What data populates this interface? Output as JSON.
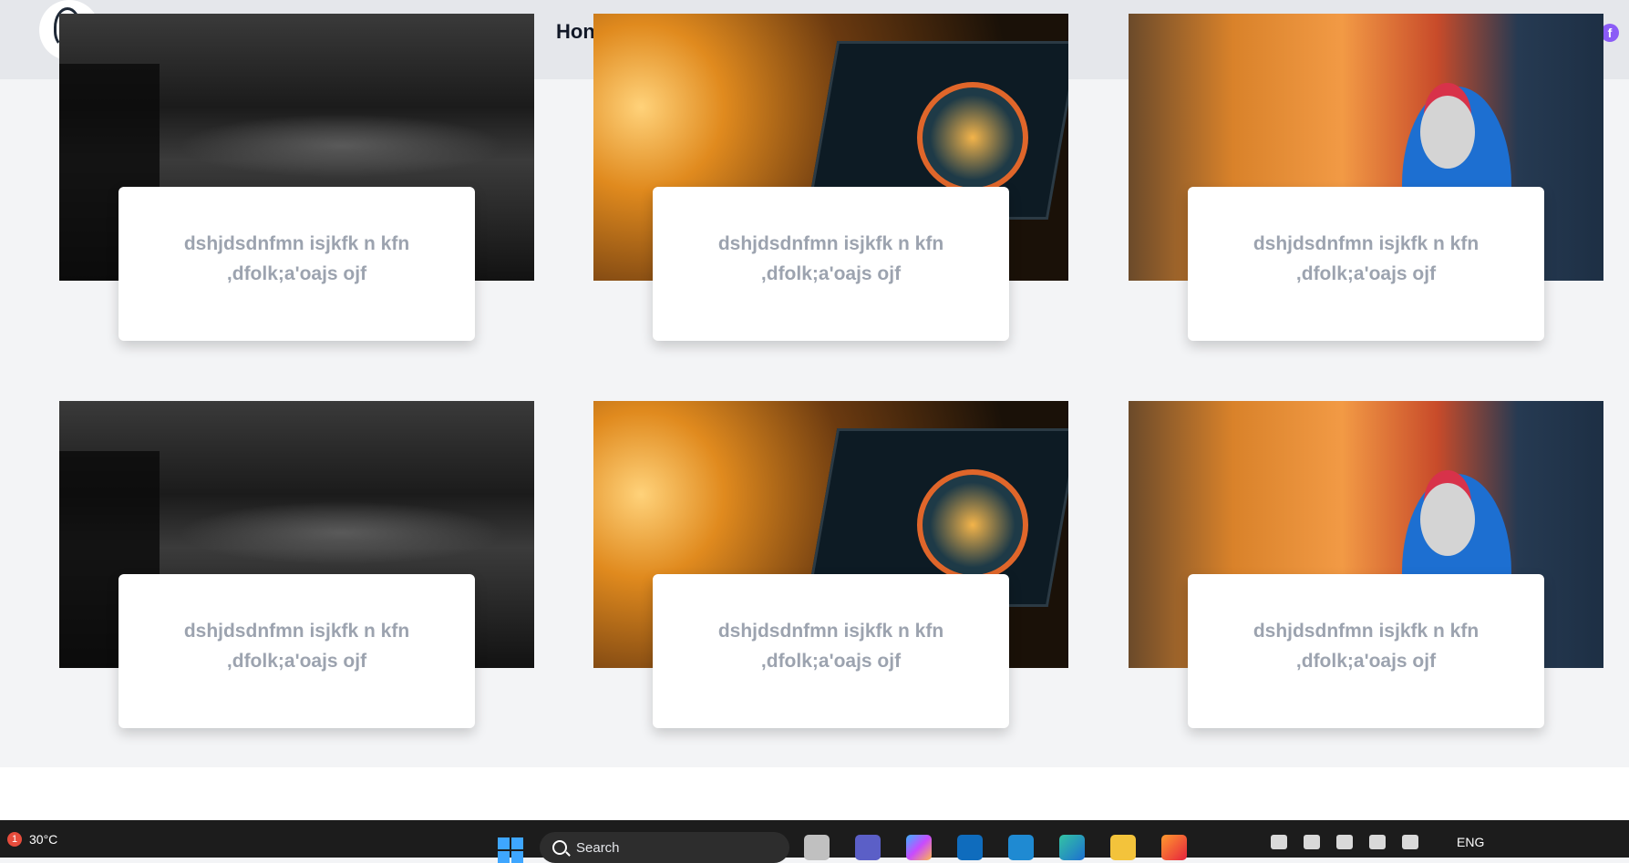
{
  "header": {
    "nav_home": "Hon",
    "social_icon": "facebook-icon",
    "social_label": "f"
  },
  "cards": [
    {
      "image": "dark-desk-photo",
      "text": "dshjdsdnfmn isjkfk n kfn ,dfolk;a'oajs ojf"
    },
    {
      "image": "laptop-speedometer-photo",
      "text": "dshjdsdnfmn isjkfk n kfn ,dfolk;a'oajs ojf"
    },
    {
      "image": "warehouse-robot-photo",
      "text": "dshjdsdnfmn isjkfk n kfn ,dfolk;a'oajs ojf"
    },
    {
      "image": "dark-desk-photo",
      "text": "dshjdsdnfmn isjkfk n kfn ,dfolk;a'oajs ojf"
    },
    {
      "image": "laptop-speedometer-photo",
      "text": "dshjdsdnfmn isjkfk n kfn ,dfolk;a'oajs ojf"
    },
    {
      "image": "warehouse-robot-photo",
      "text": "dshjdsdnfmn isjkfk n kfn ,dfolk;a'oajs ojf"
    }
  ],
  "taskbar": {
    "weather_badge": "1",
    "weather_temp": "30°C",
    "search_placeholder": "Search",
    "language": "ENG",
    "apps": [
      "file-explorer-icon",
      "teams-icon",
      "copilot-icon",
      "outlook-icon",
      "vscode-icon",
      "edge-icon",
      "folder-icon",
      "firefox-icon"
    ]
  },
  "colors": {
    "page_bg": "#f3f4f6",
    "header_bg": "#e5e7eb",
    "card_text": "#9ca3af",
    "taskbar_bg": "#1c1c1c",
    "accent": "#8b5cf6"
  }
}
